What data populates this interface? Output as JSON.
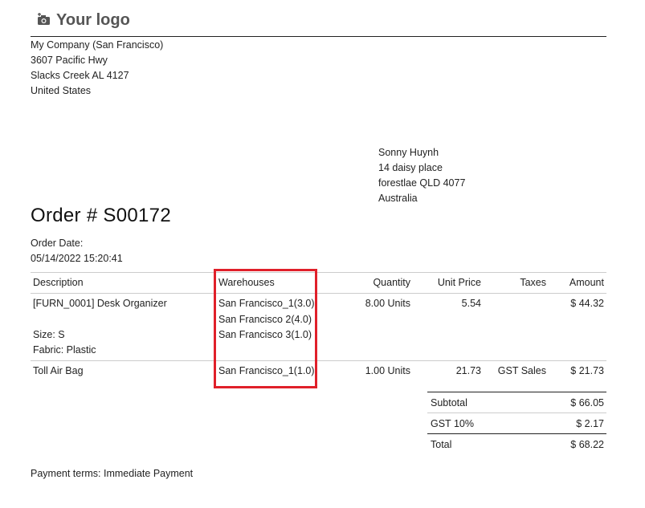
{
  "logo": {
    "text": "Your logo",
    "icon": "camera-plus-icon"
  },
  "company": {
    "name": "My Company (San Francisco)",
    "street": "3607 Pacific Hwy",
    "city": "Slacks Creek AL 4127",
    "country": "United States"
  },
  "partner": {
    "name": "Sonny Huynh",
    "street": "14 daisy place",
    "city": "forestlae QLD 4077",
    "country": "Australia"
  },
  "order": {
    "title": "Order # S00172",
    "date_label": "Order Date:",
    "date_value": "05/14/2022 15:20:41"
  },
  "table": {
    "headers": {
      "description": "Description",
      "warehouses": "Warehouses",
      "quantity": "Quantity",
      "unit_price": "Unit Price",
      "taxes": "Taxes",
      "amount": "Amount"
    },
    "rows": [
      {
        "description": "[FURN_0001] Desk Organizer",
        "desc_extra_1": "Size: S",
        "desc_extra_2": "Fabric: Plastic",
        "warehouses": [
          "San Francisco_1(3.0)",
          "San Francisco 2(4.0)",
          "San Francisco 3(1.0)"
        ],
        "quantity": "8.00 Units",
        "unit_price": "5.54",
        "taxes": "",
        "amount": "$ 44.32"
      },
      {
        "description": "Toll Air Bag",
        "warehouses": [
          "San Francisco_1(1.0)"
        ],
        "quantity": "1.00 Units",
        "unit_price": "21.73",
        "taxes": "GST Sales",
        "amount": "$ 21.73"
      }
    ]
  },
  "totals": {
    "subtotal_label": "Subtotal",
    "subtotal_value": "$ 66.05",
    "tax_label": "GST 10%",
    "tax_value": "$ 2.17",
    "total_label": "Total",
    "total_value": "$ 68.22"
  },
  "payment_terms": "Payment terms: Immediate Payment",
  "colors": {
    "highlight": "#e0202a",
    "rule": "#222222",
    "light_rule": "#cccccc"
  }
}
